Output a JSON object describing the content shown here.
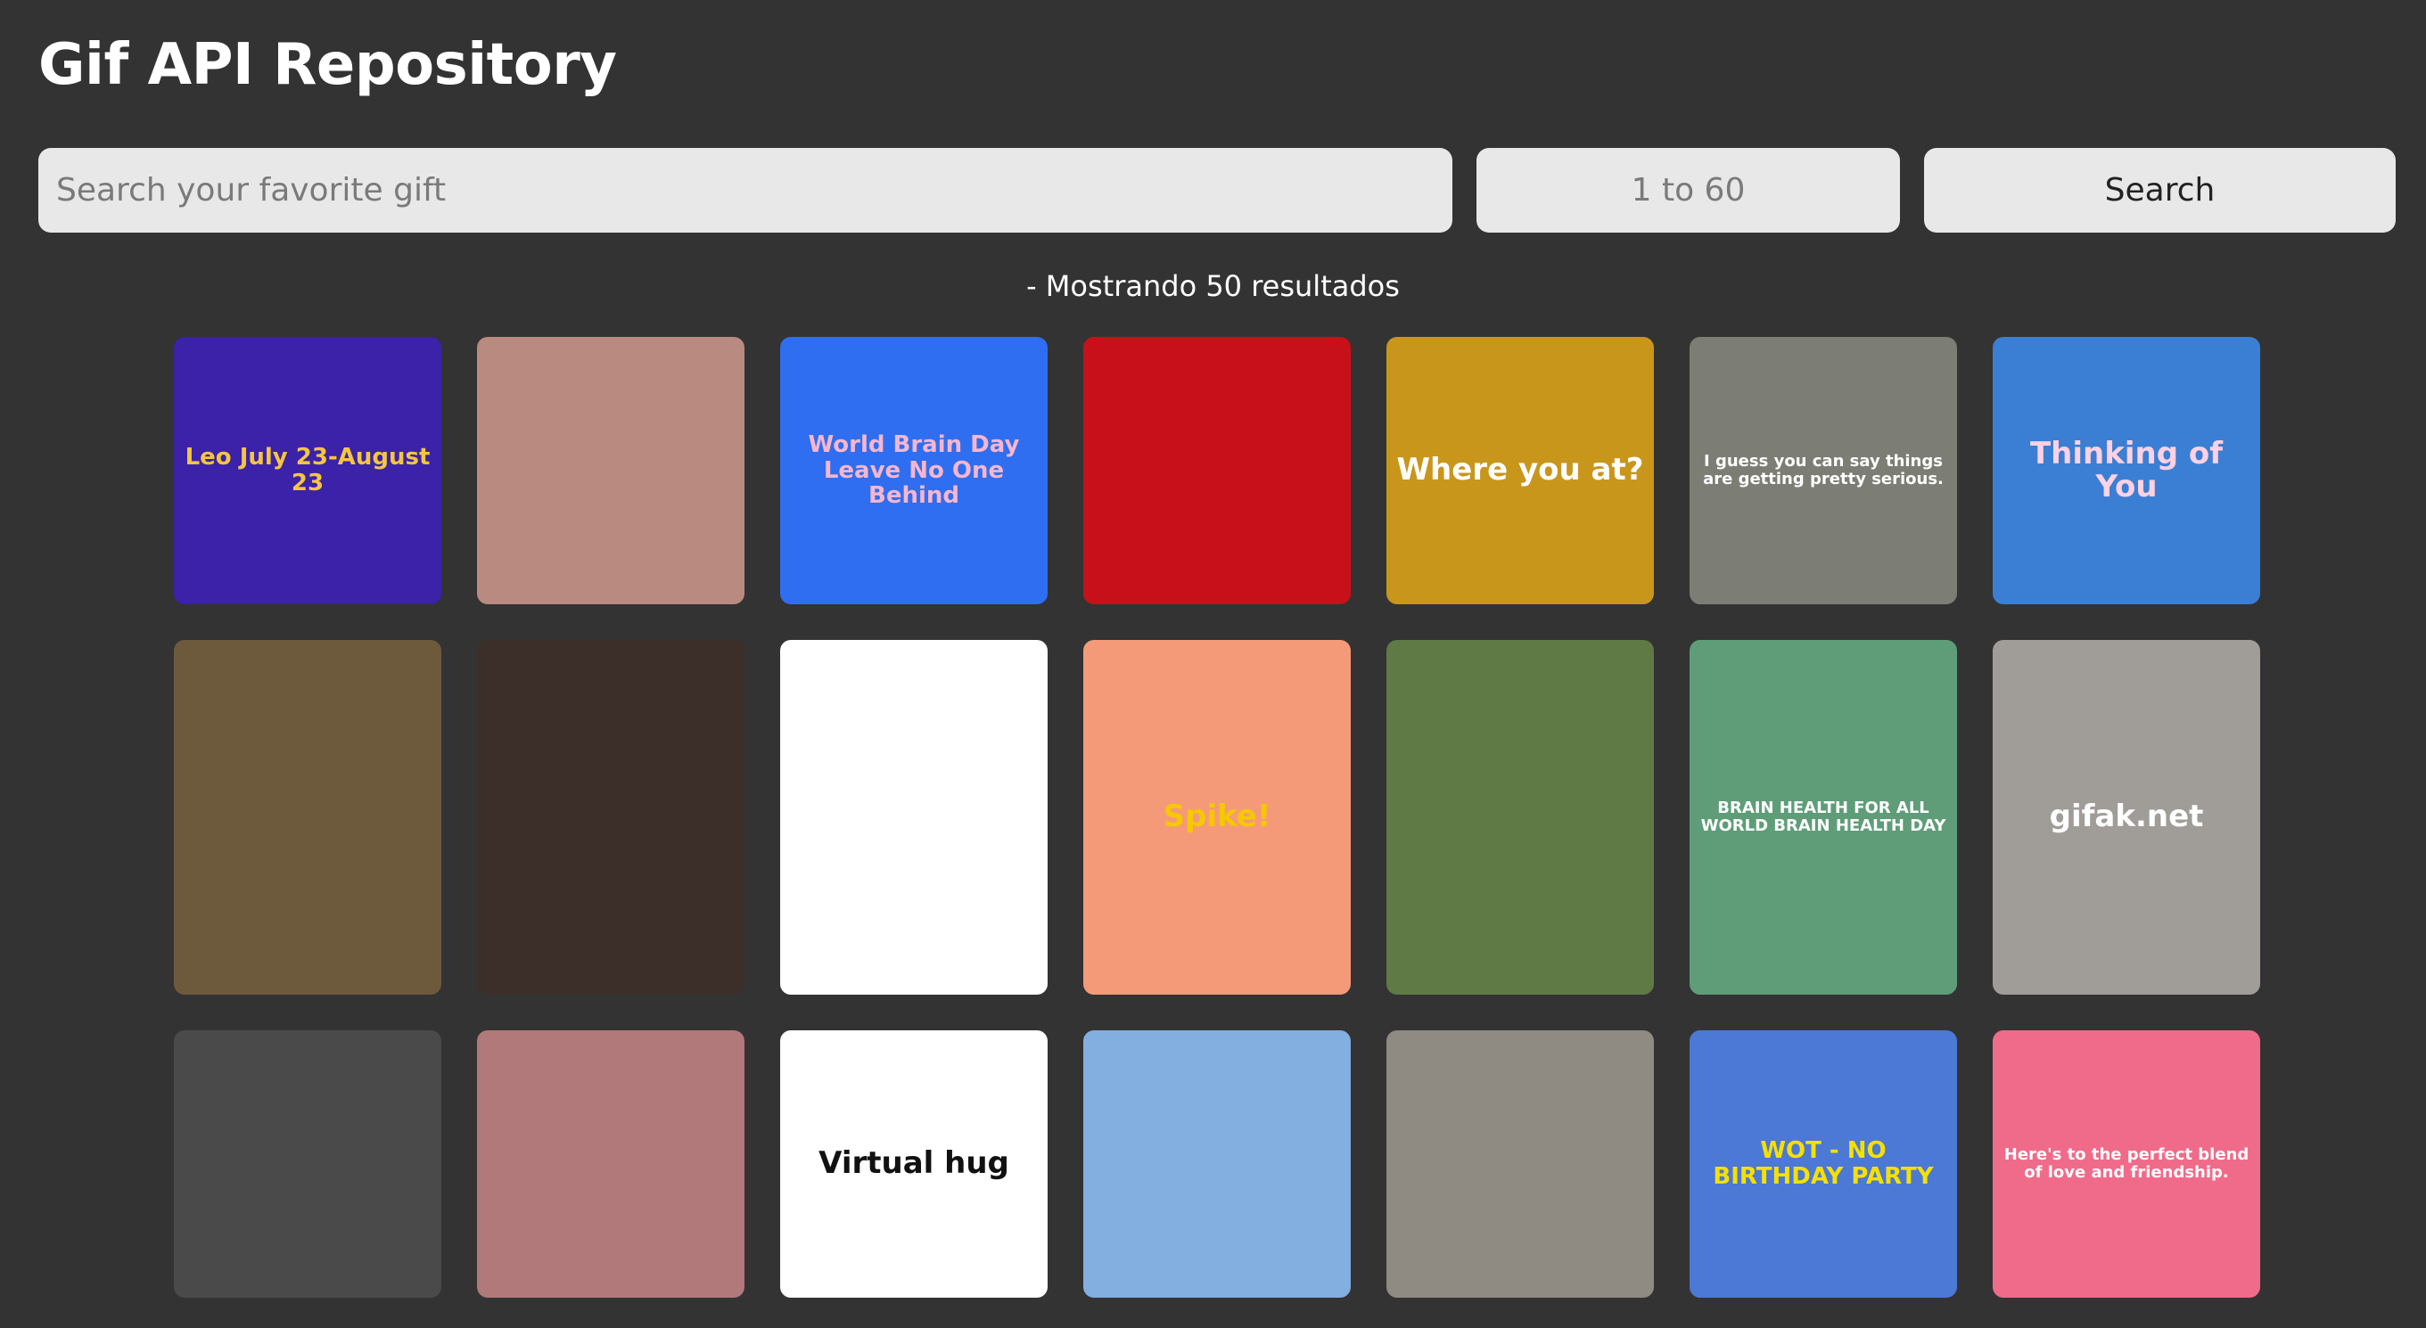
{
  "header": {
    "title": "Gif API Repository"
  },
  "search": {
    "placeholder": "Search your favorite gift",
    "range_placeholder": "1 to 60",
    "button_label": "Search"
  },
  "results": {
    "label": "- Mostrando 50 resultados"
  },
  "gifs": [
    {
      "caption": "Leo July 23-August 23",
      "bg": "#3b22a8",
      "fg": "#f4c542"
    },
    {
      "caption": "",
      "bg": "#b98a80",
      "fg": "#ffffff"
    },
    {
      "caption": "World Brain Day Leave No One Behind",
      "bg": "#2f6ef0",
      "fg": "#f7b6cf"
    },
    {
      "caption": "",
      "bg": "#c8101a",
      "fg": "#ffffff"
    },
    {
      "caption": "Where you at?",
      "bg": "#c9961c",
      "fg": "#ffffff"
    },
    {
      "caption": "I guess you can say things are getting pretty serious.",
      "bg": "#7c7d74",
      "fg": "#ffffff"
    },
    {
      "caption": "Thinking of You",
      "bg": "#3a7fd4",
      "fg": "#ffd1e3"
    },
    {
      "caption": "",
      "bg": "#6d5a3d",
      "fg": "#ffffff"
    },
    {
      "caption": "",
      "bg": "#3c2f2a",
      "fg": "#ffffff"
    },
    {
      "caption": "",
      "bg": "#ffffff",
      "fg": "#d9782b"
    },
    {
      "caption": "Spike!",
      "bg": "#f59a78",
      "fg": "#f5c800"
    },
    {
      "caption": "",
      "bg": "#5f7a45",
      "fg": "#ffffff"
    },
    {
      "caption": "BRAIN HEALTH FOR ALL WORLD BRAIN HEALTH DAY",
      "bg": "#5e9d78",
      "fg": "#ffffff"
    },
    {
      "caption": "gifak.net",
      "bg": "#a09c98",
      "fg": "#ffffff"
    },
    {
      "caption": "",
      "bg": "#4a4a4a",
      "fg": "#ffffff"
    },
    {
      "caption": "",
      "bg": "#b1797a",
      "fg": "#ffffff"
    },
    {
      "caption": "Virtual hug",
      "bg": "#ffffff",
      "fg": "#111111"
    },
    {
      "caption": "",
      "bg": "#82aee0",
      "fg": "#ffffff"
    },
    {
      "caption": "",
      "bg": "#8f8a82",
      "fg": "#ffffff"
    },
    {
      "caption": "WOT - NO BIRTHDAY PARTY",
      "bg": "#4c78d6",
      "fg": "#f5e000"
    },
    {
      "caption": "Here's to the perfect blend of love and friendship.",
      "bg": "#f06b8a",
      "fg": "#ffffff"
    }
  ]
}
